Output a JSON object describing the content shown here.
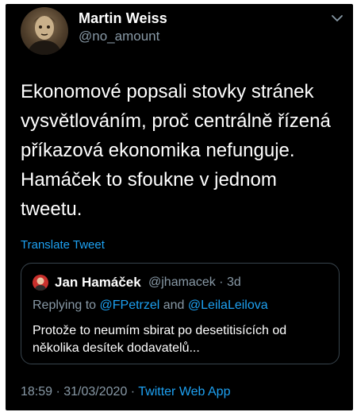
{
  "tweet": {
    "author_name": "Martin Weiss",
    "author_handle": "@no_amount",
    "text": "Ekonomové popsali stovky stránek\nvysvětlováním, proč centrálně řízená\npříkazová ekonomika nefunguje.\nHamáček to sfoukne v jednom\ntweetu.",
    "translate_label": "Translate Tweet",
    "menu_icon": "chevron-down-icon",
    "timestamp": "18:59 · 31/03/2020 · ",
    "source": "Twitter Web App"
  },
  "quoted": {
    "author_name": "Jan Hamáček",
    "author_handle": "@jhamacek · 3d",
    "reply_prefix": "Replying to ",
    "reply_user_1": "@FPetrzel",
    "reply_and": " and ",
    "reply_user_2": "@LeilaLeilova",
    "text": "Protože to neumím sbirat po desetitisících od\nněkolika desítek dodavatelů..."
  },
  "colors": {
    "background": "#000000",
    "accent": "#1da1f2",
    "muted": "#8899a6",
    "border": "#38444d"
  }
}
